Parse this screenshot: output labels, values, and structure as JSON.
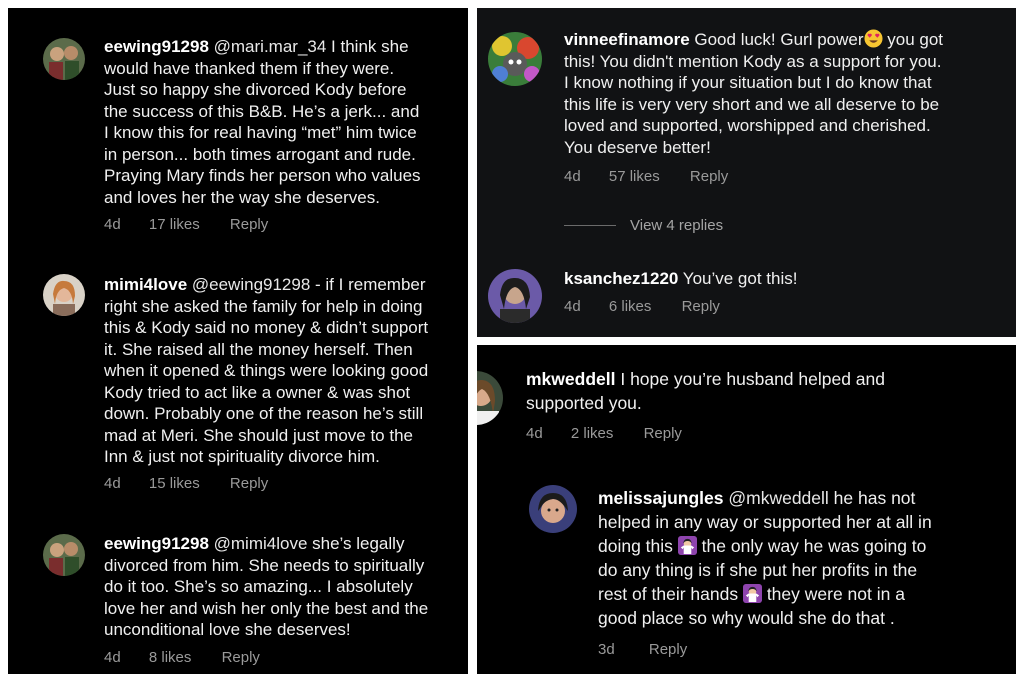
{
  "comments_left": [
    {
      "username": "eewing91298",
      "mention": "@mari.mar_34",
      "lines": [
        " I think she",
        "would have thanked them if they were.",
        "Just so happy she divorced Kody before",
        "the success of this B&B. He’s a jerk... and",
        "I know this for real having “met” him twice",
        "in person... both times arrogant and rude.",
        "Praying Mary finds her person who values",
        "and loves her the way she deserves."
      ],
      "time": "4d",
      "likes": "17 likes",
      "reply": "Reply"
    },
    {
      "username": "mimi4love",
      "mention": "@eewing91298",
      "lines": [
        " - if I remember",
        "right she asked the family for help in doing",
        "this & Kody said no money & didn’t support",
        "it. She raised all the money herself. Then",
        "when it opened & things were looking good",
        "Kody tried to act like a owner & was shot",
        "down. Probably one of the reason he’s still",
        "mad at Meri. She should just move to the",
        "Inn & just not spirituality divorce him."
      ],
      "time": "4d",
      "likes": "15 likes",
      "reply": "Reply"
    },
    {
      "username": "eewing91298",
      "mention": "@mimi4love",
      "lines": [
        " she’s legally",
        "divorced from him. She needs to spiritually",
        "do it too. She’s so amazing... I absolutely",
        "love her and wish her only the best and the",
        "unconditional love she deserves!"
      ],
      "time": "4d",
      "likes": "8 likes",
      "reply": "Reply"
    }
  ],
  "comments_top_right": [
    {
      "username": "vinneefinamore",
      "lines": [
        " Good luck!  Gurl power",
        "this!  You didn't mention Kody as a support for you.",
        "I know nothing if your situation but I do know that",
        "this life is very very short and we all deserve to be",
        "loved and supported, worshipped and cherished.",
        "You deserve better!"
      ],
      "line1_tail": " you got",
      "emoji": "heart-eyes-emoji",
      "time": "4d",
      "likes": "57 likes",
      "reply": "Reply"
    },
    {
      "username": "ksanchez1220",
      "lines": [
        " You’ve got this!"
      ],
      "time": "4d",
      "likes": "6 likes",
      "reply": "Reply"
    }
  ],
  "view_replies": "View 4 replies",
  "comments_bottom_right": [
    {
      "username": "mkweddell",
      "lines": [
        " I hope you’re husband helped and",
        "supported you."
      ],
      "time": "4d",
      "likes": "2 likes",
      "reply": "Reply"
    },
    {
      "username": "melissajungles",
      "mention": "@mkweddell",
      "lines": [
        " he has not",
        "helped in any way or supported her at all in",
        "doing this",
        " the only way he was going to",
        "do any thing is if she put her profits in the",
        "rest of their hands",
        " they were not in a",
        "good place so why would she do that ."
      ],
      "emoji": "person-shrugging-emoji",
      "time": "3d",
      "reply": "Reply"
    }
  ]
}
